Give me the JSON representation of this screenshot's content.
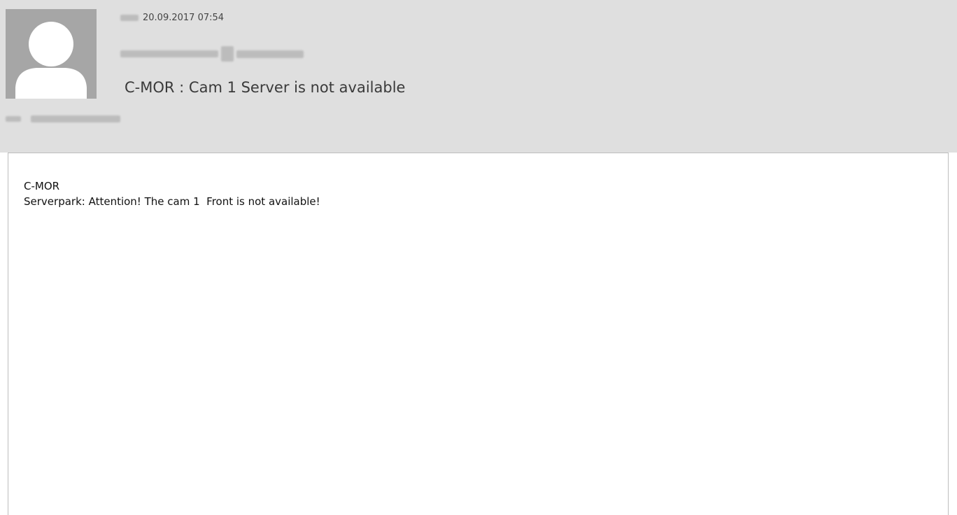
{
  "message": {
    "date_time": "20.09.2017 07:54",
    "subject": "C-MOR : Cam 1 Server is not available",
    "body_lines": [
      "C-MOR",
      "Serverpark: Attention! The cam 1  Front is not available!"
    ]
  },
  "icons": {
    "avatar": "person-placeholder-icon"
  },
  "colors": {
    "header_background": "#dfdfdf",
    "avatar_background": "#a6a6a6",
    "body_background": "#ffffff"
  }
}
